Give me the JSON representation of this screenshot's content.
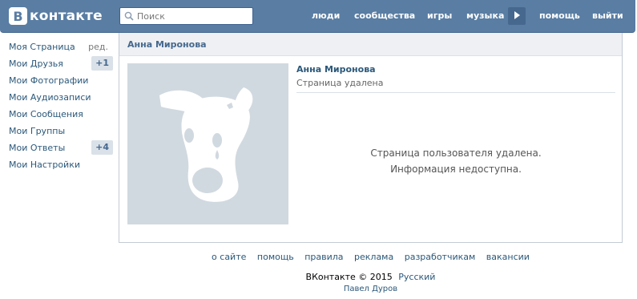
{
  "header": {
    "logo_letter": "В",
    "logo_text": "контакте",
    "search_placeholder": "Поиск",
    "nav": [
      "люди",
      "сообщества",
      "игры",
      "музыка",
      "помощь",
      "выйти"
    ]
  },
  "sidebar": {
    "items": [
      {
        "label": "Моя Страница",
        "extra": "ред."
      },
      {
        "label": "Мои Друзья",
        "badge": "+1"
      },
      {
        "label": "Мои Фотографии"
      },
      {
        "label": "Мои Аудиозаписи"
      },
      {
        "label": "Мои Сообщения"
      },
      {
        "label": "Мои Группы"
      },
      {
        "label": "Мои Ответы",
        "badge": "+4"
      },
      {
        "label": "Мои Настройки"
      }
    ]
  },
  "main": {
    "header_title": "Анна Миронова",
    "profile_name": "Анна Миронова",
    "profile_status": "Страница удалена",
    "deleted_line1": "Страница пользователя удалена.",
    "deleted_line2": "Информация недоступна."
  },
  "footer": {
    "links": [
      "о сайте",
      "помощь",
      "правила",
      "реклама",
      "разработчикам",
      "вакансии"
    ],
    "copyright": "ВКонтакте © 2015",
    "language": "Русский",
    "author": "Павел Дуров"
  },
  "colors": {
    "header_bg": "#597da3",
    "link": "#2b587a",
    "panel_header_bg": "#eef0f3",
    "avatar_bg": "#d1d9e0",
    "badge_bg": "#dae1e8"
  }
}
